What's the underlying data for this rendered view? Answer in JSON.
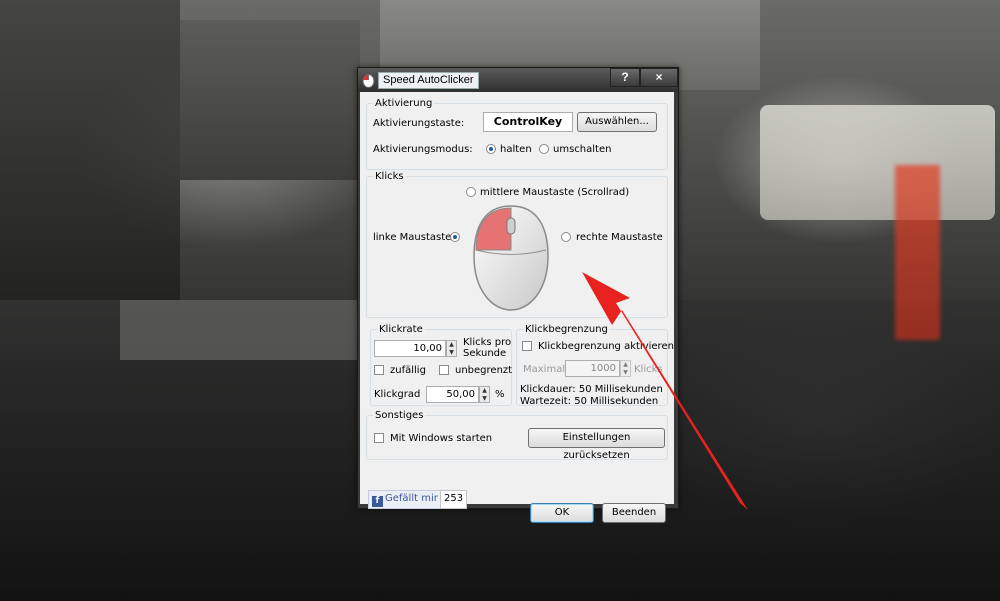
{
  "window": {
    "title": "Speed AutoClicker",
    "help_label": "?",
    "close_label": "×"
  },
  "activation": {
    "legend": "Aktivierung",
    "key_label": "Aktivierungstaste:",
    "key_value": "ControlKey",
    "select_button": "Auswählen...",
    "mode_label": "Aktivierungsmodus:",
    "mode_hold": "halten",
    "mode_toggle": "umschalten",
    "mode_selected": "halten"
  },
  "clicks": {
    "legend": "Klicks",
    "middle_button": "mittlere Maustaste (Scrollrad)",
    "left_button": "linke Maustaste",
    "right_button": "rechte Maustaste",
    "selected": "linke Maustaste"
  },
  "click_rate": {
    "legend": "Klickrate",
    "value": "10,00",
    "unit": "Klicks pro Sekunde",
    "random": "zufällig",
    "unlimited": "unbegrenzt",
    "degree_label": "Klickgrad",
    "degree_value": "50,00",
    "degree_unit": "%"
  },
  "click_limit": {
    "legend": "Klickbegrenzung",
    "enable_label": "Klickbegrenzung aktivieren",
    "max_label": "Maximal",
    "max_value": "1000",
    "max_unit": "Klicks",
    "duration": "Klickdauer: 50 Millisekunden",
    "wait": "Wartezeit: 50 Millisekunden"
  },
  "misc": {
    "legend": "Sonstiges",
    "autostart": "Mit Windows starten",
    "reset_button": "Einstellungen zurücksetzen"
  },
  "footer": {
    "like_label": "Gefällt mir",
    "like_count": "253",
    "ok_button": "OK",
    "quit_button": "Beenden"
  },
  "colors": {
    "annotation_arrow": "#e8231f",
    "mouse_highlight": "#e57373"
  },
  "icons": {
    "app": "mouse-app-icon",
    "facebook": "facebook-f-icon",
    "mouse": "mouse-illustration"
  }
}
